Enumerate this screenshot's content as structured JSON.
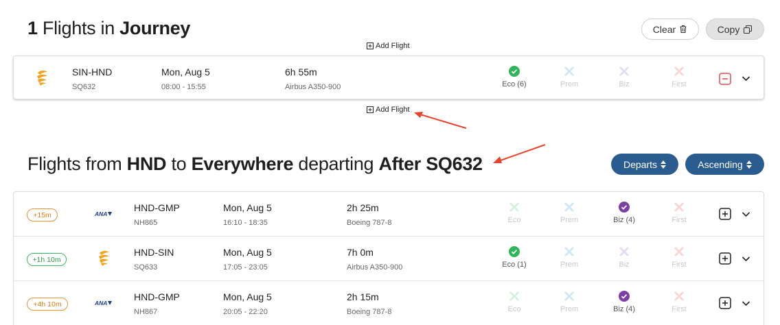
{
  "journey": {
    "count": "1",
    "title_mid": " Flights in ",
    "title_bold": "Journey",
    "clear_label": "Clear",
    "copy_label": "Copy",
    "add_flight_label": "Add Flight"
  },
  "selected_flight": {
    "route": "SIN-HND",
    "flight_no": "SQ632",
    "date": "Mon, Aug 5",
    "times": "08:00 - 15:55",
    "duration": "6h 55m",
    "aircraft": "Airbus A350-900",
    "airline_logo": "singapore-airlines-logo",
    "cabins": [
      {
        "label": "Eco (6)",
        "available": true,
        "icon": "check-icon"
      },
      {
        "label": "Prem",
        "available": false,
        "icon": "x-icon"
      },
      {
        "label": "Biz",
        "available": false,
        "icon": "x-icon"
      },
      {
        "label": "First",
        "available": false,
        "icon": "x-icon"
      }
    ]
  },
  "results": {
    "title_1": "Flights from ",
    "origin": "HND",
    "title_2": " to ",
    "dest": "Everywhere",
    "title_3": " departing ",
    "after": "After SQ632",
    "sort_field": "Departs",
    "sort_order": "Ascending"
  },
  "flights": [
    {
      "delta": "+15m",
      "delta_color": "orange",
      "airline_logo": "ana-logo",
      "route": "HND-GMP",
      "flight_no": "NH865",
      "date": "Mon, Aug 5",
      "times": "16:10 - 18:35",
      "duration": "2h 25m",
      "aircraft": "Boeing 787-8",
      "cabins": [
        {
          "label": "Eco",
          "available": false,
          "icon": "x-icon"
        },
        {
          "label": "Prem",
          "available": false,
          "icon": "x-icon"
        },
        {
          "label": "Biz (4)",
          "available": true,
          "icon": "check-icon"
        },
        {
          "label": "First",
          "available": false,
          "icon": "x-icon"
        }
      ]
    },
    {
      "delta": "+1h 10m",
      "delta_color": "green",
      "airline_logo": "singapore-airlines-logo",
      "route": "HND-SIN",
      "flight_no": "SQ633",
      "date": "Mon, Aug 5",
      "times": "17:05 - 23:05",
      "duration": "7h 0m",
      "aircraft": "Airbus A350-900",
      "cabins": [
        {
          "label": "Eco (1)",
          "available": true,
          "icon": "check-icon"
        },
        {
          "label": "Prem",
          "available": false,
          "icon": "x-icon"
        },
        {
          "label": "Biz",
          "available": false,
          "icon": "x-icon"
        },
        {
          "label": "First",
          "available": false,
          "icon": "x-icon"
        }
      ]
    },
    {
      "delta": "+4h 10m",
      "delta_color": "orange",
      "airline_logo": "ana-logo",
      "route": "HND-GMP",
      "flight_no": "NH867",
      "date": "Mon, Aug 5",
      "times": "20:05 - 22:20",
      "duration": "2h 15m",
      "aircraft": "Boeing 787-8",
      "cabins": [
        {
          "label": "Eco",
          "available": false,
          "icon": "x-icon"
        },
        {
          "label": "Prem",
          "available": false,
          "icon": "x-icon"
        },
        {
          "label": "Biz (4)",
          "available": true,
          "icon": "check-icon"
        },
        {
          "label": "First",
          "available": false,
          "icon": "x-icon"
        }
      ]
    }
  ],
  "colors": {
    "accent": "#2b5c8f",
    "eco_check": "#2fb55a",
    "biz_check": "#7b3fa6",
    "x_prem": "#cfe8f3",
    "x_biz": "#e6dcef",
    "x_first": "#f8d6d6",
    "x_eco": "#d8f0e0",
    "remove": "#e04a4a",
    "annotation_arrow": "#e8432b"
  }
}
